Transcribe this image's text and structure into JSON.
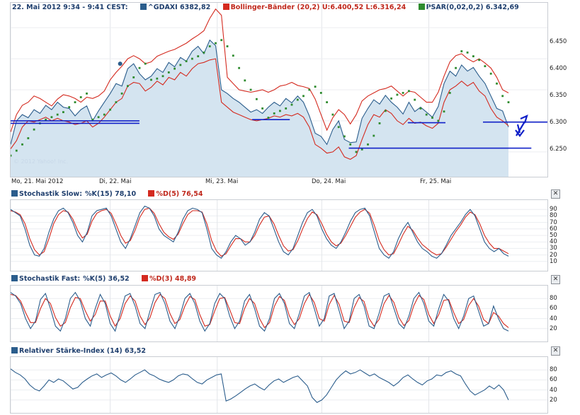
{
  "main_legend": {
    "date_range": "22. Mai 2012 9:34 - 9:41 CEST:",
    "gdaxi": "^GDAXI 6382,82",
    "bollinger": "Bollinger-Bänder (20,2) U:6.400,52 L:6.316,24",
    "psar": "PSAR(0,02,0,2) 6.342,69"
  },
  "watermark": "© 2012 Yahoo! Inc.",
  "x_labels": [
    "Mo, 21. Mai 2012",
    "Di, 22. Mai",
    "Mi, 23. Mai",
    "Do, 24. Mai",
    "Fr, 25. Mai"
  ],
  "y_ticks_main": [
    "6.450",
    "6.400",
    "6.350",
    "6.300",
    "6.250"
  ],
  "stoch_slow": {
    "title": "Stochastik Slow:",
    "k": "%K(15) 78,10",
    "d": "%D(5) 76,54",
    "ticks": [
      "90",
      "80",
      "70",
      "60",
      "50",
      "40",
      "30",
      "20",
      "10"
    ]
  },
  "stoch_fast": {
    "title": "Stochastik Fast:",
    "k": "%K(5) 36,52",
    "d": "%D(3) 48,89",
    "ticks": [
      "80",
      "60",
      "40",
      "20"
    ]
  },
  "rsi": {
    "title": "Relativer Stärke-Index (14) 63,52",
    "ticks": [
      "80",
      "60",
      "40",
      "20"
    ]
  },
  "close_symbol": "✕",
  "colors": {
    "price": "#2b5d8c",
    "fill": "#d4e4f0",
    "band": "#d42a1f",
    "psar": "#2e8b2e",
    "hline": "#1020c8",
    "k": "#2b5d8c",
    "d": "#d42a1f"
  },
  "chart_data": {
    "type": "line",
    "title": "",
    "x": [
      "Mo, 21. Mai 2012",
      "Di, 22. Mai",
      "Mi, 23. Mai",
      "Do, 24. Mai",
      "Fr, 25. Mai"
    ],
    "ylim": [
      6210,
      6490
    ],
    "series": [
      {
        "name": "^GDAXI",
        "values": [
          6262,
          6300,
          6310,
          6305,
          6318,
          6312,
          6325,
          6318,
          6330,
          6322,
          6320,
          6308,
          6318,
          6324,
          6300,
          6316,
          6330,
          6344,
          6360,
          6356,
          6384,
          6392,
          6376,
          6366,
          6372,
          6384,
          6378,
          6394,
          6387,
          6402,
          6396,
          6412,
          6420,
          6408,
          6430,
          6421,
          6350,
          6344,
          6336,
          6330,
          6322,
          6314,
          6318,
          6312,
          6322,
          6330,
          6324,
          6336,
          6329,
          6340,
          6330,
          6308,
          6280,
          6275,
          6262,
          6286,
          6300,
          6270,
          6265,
          6266,
          6304,
          6320,
          6334,
          6327,
          6341,
          6330,
          6322,
          6311,
          6330,
          6315,
          6322,
          6314,
          6306,
          6323,
          6360,
          6380,
          6372,
          6390,
          6380,
          6386,
          6372,
          6360,
          6340,
          6320,
          6316,
          6290
        ]
      },
      {
        "name": "Bollinger-Bänder U",
        "values": [
          6282,
          6310,
          6325,
          6330,
          6340,
          6336,
          6330,
          6324,
          6335,
          6342,
          6340,
          6336,
          6330,
          6338,
          6336,
          6340,
          6348,
          6366,
          6378,
          6388,
          6400,
          6405,
          6400,
          6392,
          6395,
          6404,
          6408,
          6412,
          6415,
          6420,
          6425,
          6432,
          6438,
          6445,
          6465,
          6480,
          6470,
          6370,
          6360,
          6350,
          6348,
          6346,
          6348,
          6350,
          6346,
          6350,
          6356,
          6358,
          6362,
          6357,
          6355,
          6352,
          6335,
          6310,
          6285,
          6305,
          6318,
          6310,
          6295,
          6310,
          6332,
          6340,
          6345,
          6350,
          6352,
          6356,
          6348,
          6340,
          6348,
          6346,
          6338,
          6330,
          6330,
          6346,
          6372,
          6395,
          6405,
          6408,
          6400,
          6395,
          6400,
          6393,
          6385,
          6370,
          6350,
          6345
        ]
      },
      {
        "name": "Bollinger-Bänder L",
        "values": [
          6255,
          6268,
          6290,
          6300,
          6298,
          6302,
          6306,
          6300,
          6304,
          6300,
          6298,
          6294,
          6296,
          6300,
          6290,
          6296,
          6306,
          6318,
          6330,
          6336,
          6356,
          6362,
          6360,
          6348,
          6354,
          6364,
          6358,
          6370,
          6366,
          6378,
          6372,
          6384,
          6392,
          6394,
          6398,
          6400,
          6330,
          6322,
          6314,
          6310,
          6306,
          6302,
          6300,
          6302,
          6304,
          6308,
          6306,
          6310,
          6308,
          6312,
          6306,
          6290,
          6262,
          6256,
          6248,
          6250,
          6258,
          6242,
          6238,
          6244,
          6270,
          6294,
          6310,
          6306,
          6318,
          6312,
          6300,
          6294,
          6304,
          6296,
          6298,
          6292,
          6288,
          6296,
          6330,
          6350,
          6356,
          6364,
          6356,
          6362,
          6348,
          6340,
          6320,
          6306,
          6300,
          6292
        ]
      }
    ],
    "psar": [
      6244,
      6252,
      6262,
      6272,
      6286,
      6296,
      6302,
      6306,
      6310,
      6314,
      6322,
      6330,
      6338,
      6344,
      6302,
      6306,
      6310,
      6318,
      6330,
      6344,
      6356,
      6370,
      6385,
      6392,
      6366,
      6368,
      6372,
      6378,
      6384,
      6390,
      6396,
      6400,
      6404,
      6410,
      6420,
      6425,
      6430,
      6420,
      6405,
      6385,
      6365,
      6350,
      6335,
      6320,
      6305,
      6312,
      6316,
      6320,
      6326,
      6334,
      6340,
      6350,
      6355,
      6345,
      6330,
      6310,
      6290,
      6275,
      6262,
      6250,
      6254,
      6262,
      6276,
      6296,
      6316,
      6336,
      6342,
      6345,
      6348,
      6334,
      6320,
      6310,
      6305,
      6300,
      6315,
      6345,
      6385,
      6412,
      6410,
      6404,
      6398,
      6388,
      6376,
      6360,
      6340,
      6330
    ],
    "hlines": [
      [
        0,
        0.24,
        6300
      ],
      [
        0,
        0.24,
        6296
      ],
      [
        0.45,
        0.52,
        6302
      ],
      [
        0.63,
        0.97,
        6256
      ],
      [
        0.74,
        0.81,
        6297
      ],
      [
        0.88,
        1,
        6298
      ]
    ],
    "stoch_slow": {
      "ylim": [
        0,
        100
      ],
      "k": [
        90,
        85,
        80,
        60,
        35,
        20,
        18,
        30,
        55,
        75,
        88,
        92,
        85,
        70,
        50,
        40,
        55,
        80,
        88,
        90,
        92,
        80,
        60,
        40,
        30,
        45,
        65,
        85,
        95,
        92,
        80,
        60,
        50,
        45,
        40,
        55,
        75,
        88,
        92,
        90,
        85,
        60,
        30,
        20,
        15,
        25,
        40,
        50,
        45,
        35,
        40,
        55,
        75,
        85,
        80,
        60,
        40,
        25,
        20,
        30,
        50,
        70,
        85,
        90,
        80,
        60,
        45,
        35,
        30,
        40,
        55,
        72,
        85,
        90,
        92,
        80,
        55,
        30,
        20,
        15,
        25,
        45,
        60,
        70,
        55,
        40,
        30,
        25,
        18,
        15,
        22,
        35,
        50,
        60,
        70,
        82,
        90,
        80,
        60,
        40,
        30,
        25,
        30,
        22,
        18
      ],
      "d": [
        88,
        86,
        82,
        68,
        45,
        28,
        20,
        25,
        45,
        68,
        82,
        88,
        86,
        75,
        58,
        46,
        52,
        72,
        84,
        88,
        90,
        84,
        68,
        50,
        38,
        42,
        58,
        78,
        90,
        92,
        84,
        68,
        55,
        48,
        44,
        52,
        68,
        82,
        88,
        88,
        86,
        68,
        42,
        26,
        18,
        22,
        34,
        45,
        45,
        40,
        40,
        50,
        66,
        78,
        80,
        68,
        50,
        34,
        26,
        28,
        42,
        60,
        76,
        86,
        82,
        68,
        52,
        40,
        34,
        38,
        50,
        64,
        78,
        86,
        90,
        84,
        65,
        42,
        28,
        20,
        22,
        36,
        52,
        64,
        58,
        46,
        36,
        30,
        24,
        20,
        22,
        32,
        44,
        56,
        66,
        78,
        86,
        82,
        68,
        50,
        38,
        30,
        30,
        26,
        22
      ]
    },
    "stoch_fast": {
      "ylim": [
        0,
        100
      ],
      "k": [
        92,
        85,
        70,
        40,
        20,
        35,
        78,
        90,
        60,
        25,
        15,
        40,
        80,
        92,
        75,
        40,
        25,
        60,
        88,
        70,
        30,
        15,
        50,
        85,
        90,
        65,
        30,
        20,
        55,
        88,
        92,
        70,
        35,
        20,
        45,
        80,
        90,
        70,
        35,
        15,
        30,
        70,
        90,
        80,
        45,
        20,
        35,
        75,
        88,
        60,
        25,
        15,
        40,
        80,
        90,
        70,
        30,
        20,
        50,
        85,
        92,
        60,
        25,
        40,
        85,
        90,
        55,
        20,
        35,
        80,
        88,
        65,
        25,
        20,
        50,
        85,
        90,
        60,
        30,
        20,
        45,
        80,
        92,
        70,
        35,
        25,
        60,
        88,
        75,
        40,
        20,
        45,
        80,
        85,
        55,
        25,
        30,
        65,
        40,
        20,
        15
      ],
      "d": [
        88,
        86,
        75,
        52,
        32,
        32,
        60,
        80,
        70,
        42,
        25,
        32,
        62,
        82,
        80,
        55,
        35,
        48,
        75,
        75,
        45,
        25,
        40,
        70,
        85,
        75,
        45,
        28,
        42,
        72,
        88,
        80,
        50,
        30,
        38,
        65,
        84,
        78,
        48,
        25,
        28,
        55,
        80,
        82,
        58,
        32,
        30,
        60,
        80,
        70,
        40,
        22,
        32,
        65,
        84,
        76,
        45,
        28,
        40,
        70,
        88,
        72,
        40,
        35,
        68,
        86,
        68,
        35,
        32,
        62,
        82,
        74,
        40,
        25,
        38,
        70,
        86,
        72,
        42,
        26,
        36,
        66,
        86,
        78,
        48,
        30,
        48,
        76,
        78,
        52,
        30,
        38,
        66,
        80,
        65,
        38,
        30,
        52,
        45,
        30,
        22
      ]
    },
    "rsi": {
      "ylim": [
        0,
        100
      ],
      "values": [
        82,
        75,
        70,
        62,
        50,
        42,
        38,
        48,
        60,
        55,
        62,
        58,
        50,
        42,
        45,
        55,
        62,
        68,
        72,
        65,
        70,
        74,
        68,
        60,
        55,
        62,
        70,
        75,
        80,
        72,
        68,
        62,
        58,
        55,
        60,
        68,
        72,
        70,
        62,
        55,
        52,
        60,
        65,
        70,
        72,
        18,
        22,
        28,
        35,
        42,
        48,
        52,
        45,
        40,
        50,
        58,
        62,
        55,
        60,
        65,
        68,
        58,
        48,
        25,
        15,
        20,
        30,
        45,
        60,
        70,
        78,
        72,
        75,
        80,
        74,
        68,
        72,
        65,
        60,
        55,
        48,
        55,
        65,
        70,
        62,
        55,
        50,
        58,
        62,
        70,
        68,
        75,
        78,
        72,
        68,
        52,
        38,
        30,
        35,
        40,
        48,
        42,
        50,
        40,
        20
      ]
    }
  }
}
